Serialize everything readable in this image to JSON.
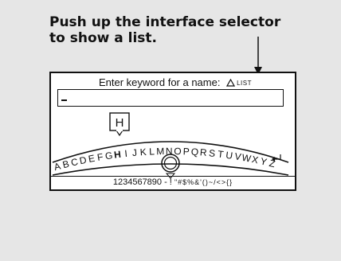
{
  "instruction": {
    "line1": "Push up the interface selector",
    "line2": "to show a list."
  },
  "screen": {
    "prompt": "Enter keyword for a name:",
    "list_icon": "triangle-up-icon",
    "list_label": "LIST",
    "keyword_value": "",
    "highlighted_letter": "H",
    "alphabet": [
      "A",
      "B",
      "C",
      "D",
      "E",
      "F",
      "G",
      "H",
      "I",
      "J",
      "K",
      "L",
      "M",
      "N",
      "O",
      "P",
      "Q",
      "R",
      "S",
      "T",
      "U",
      "V",
      "W",
      "X",
      "Y",
      "Z"
    ],
    "enter_icon": "return-arrow-icon",
    "knob_icon": "interface-dial-icon",
    "numbers": "1234567890 - !",
    "symbols": "\"#$%&'()~/<>{}"
  }
}
